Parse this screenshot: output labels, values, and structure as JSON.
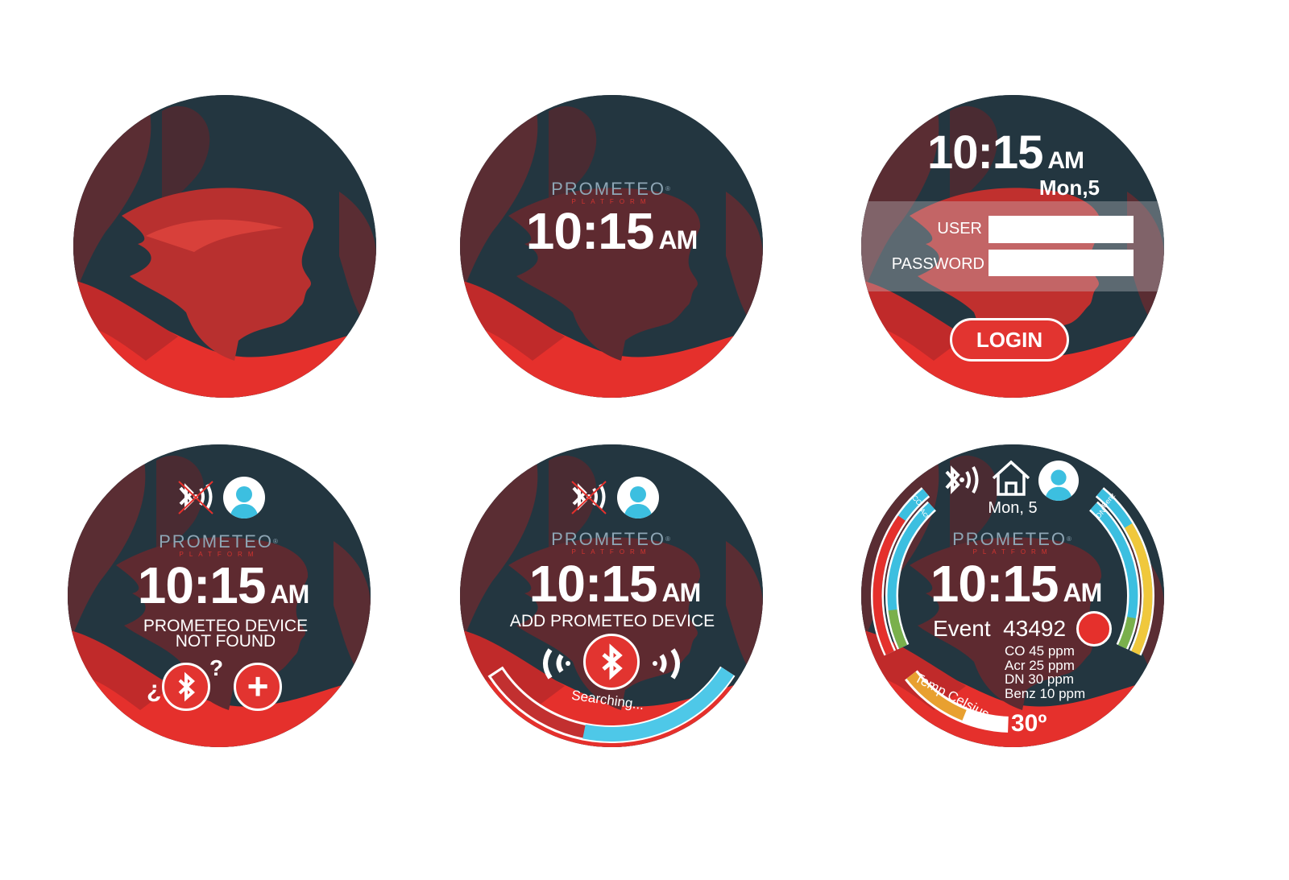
{
  "colors": {
    "dark": "#233640",
    "maroon": "#5a2d33",
    "red": "#e5302c",
    "accent_blue": "#3cbfe0",
    "green": "#7ab04c",
    "yellow": "#f0c83c",
    "orange": "#e8a030"
  },
  "brand": {
    "name": "PROMETEO",
    "registered": "®",
    "sub": "PLATFORM"
  },
  "clock": {
    "time": "10:15",
    "ampm": "AM",
    "date_short": "Mon,5",
    "date": "Mon, 5"
  },
  "login_screen": {
    "user_label": "USER",
    "password_label": "PASSWORD",
    "user_value": "",
    "password_value": "",
    "login_button": "LOGIN"
  },
  "not_found_screen": {
    "line1": "PROMETEO DEVICE",
    "line2": "NOT FOUND",
    "bluetooth_help_prefix": "¿",
    "bluetooth_help_suffix": "?",
    "add_symbol": "+"
  },
  "search_screen": {
    "title": "ADD PROMETEO DEVICE",
    "status": "Searching...",
    "progress": 0.4
  },
  "dashboard": {
    "event_label": "Event",
    "event_id": "43492",
    "readings": [
      "CO 45 ppm",
      "Acr 25 ppm",
      "DN 30 ppm",
      "Benz 10 ppm"
    ],
    "gauges": [
      {
        "label": "CO",
        "level": 0.8,
        "color": "#e5302c"
      },
      {
        "label": "Acr",
        "level": 0.25,
        "color": "#7ab04c"
      },
      {
        "label": "DN",
        "level": 0.2,
        "color": "#7ab04c"
      },
      {
        "label": "Benz",
        "level": 0.75,
        "color": "#f0c83c"
      }
    ],
    "temp_label": "Temp Celsius",
    "temp_value": "30º",
    "temp_level": 0.6
  }
}
